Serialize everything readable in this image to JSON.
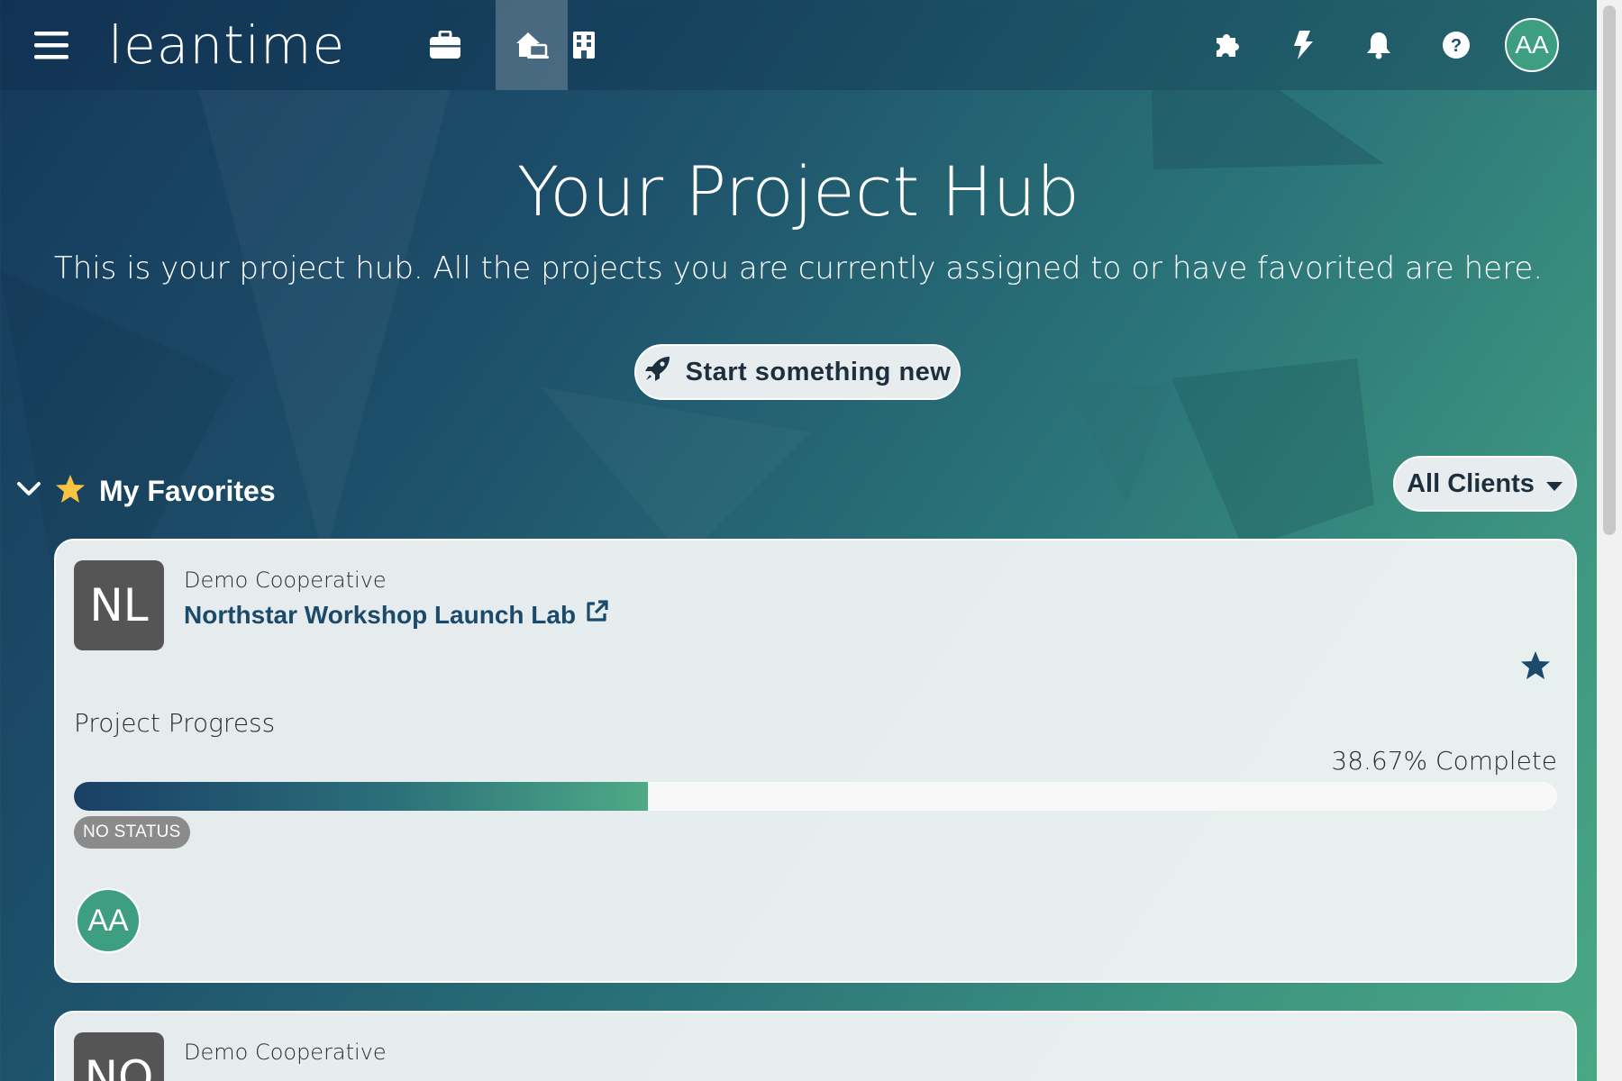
{
  "colors": {
    "accent": "#1b4a6b",
    "avatar_green": "#3d9e80",
    "project_avatar": "#555555",
    "status_gray": "#8b8b8b"
  },
  "header": {
    "logo": "leantime",
    "menu_icon": "hamburger-icon",
    "nav": [
      {
        "name": "projects",
        "icon": "briefcase-icon",
        "active": false
      },
      {
        "name": "project-hub",
        "icon": "house-laptop-icon",
        "active": true
      },
      {
        "name": "company",
        "icon": "building-icon",
        "active": false
      }
    ],
    "right_icons": [
      "puzzle-icon",
      "bolt-icon",
      "bell-icon",
      "question-circle-icon"
    ],
    "user_initials": "AA"
  },
  "hero": {
    "title": "Your Project Hub",
    "subtitle": "This is your project hub. All the projects you are currently assigned to or have favorited are here.",
    "start_button": "Start something new"
  },
  "favorites": {
    "label": "My Favorites",
    "clients_filter": "All Clients"
  },
  "projects": [
    {
      "initials": "NL",
      "client": "Demo Cooperative",
      "name": "Northstar Workshop Launch Lab",
      "progress_label": "Project Progress",
      "progress_percent": 38.67,
      "progress_text": "38.67% Complete",
      "status": "NO STATUS",
      "member_initials": "AA",
      "favorited": true
    },
    {
      "initials": "NO",
      "client": "Demo Cooperative"
    }
  ]
}
